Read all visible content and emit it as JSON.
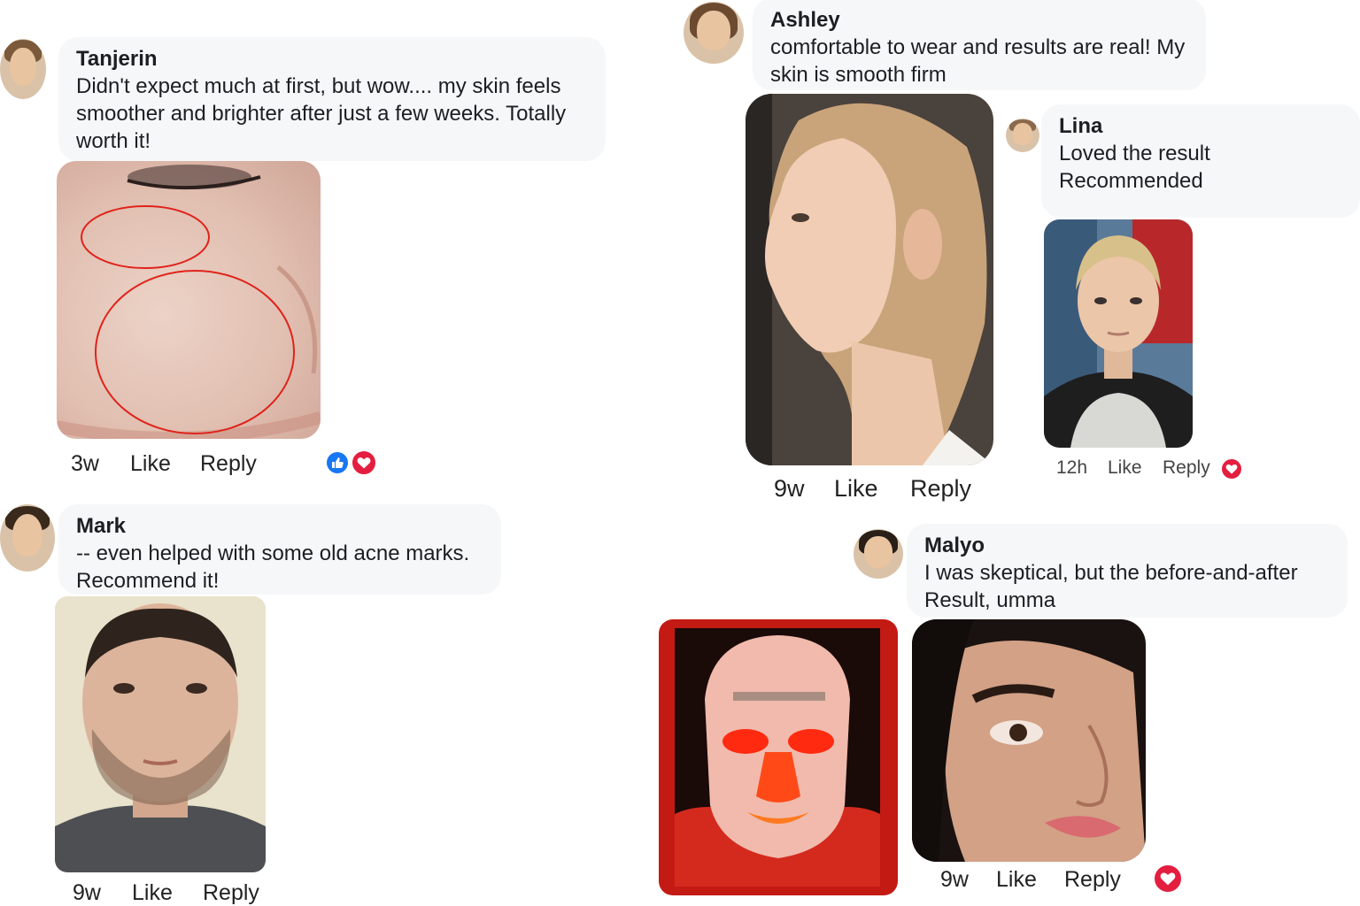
{
  "comments": [
    {
      "name": "Tanjerin",
      "text": "Didn't expect much at first, but wow.... my skin feels smoother and brighter after just a few weeks. Totally worth it!",
      "time": "3w",
      "like": "Like",
      "reply": "Reply"
    },
    {
      "name": "Mark",
      "text": "-- even helped with some old acne marks. Recommend it!",
      "time": "9w",
      "like": "Like",
      "reply": "Reply"
    },
    {
      "name": "Ashley",
      "text": "comfortable to wear and results are real! My skin is smooth firm",
      "time": "9w",
      "like": "Like",
      "reply": "Reply"
    },
    {
      "name": "Lina",
      "text_line1": "Loved the result",
      "text_line2": "Recommended",
      "time": "12h",
      "like": "Like",
      "reply": "Reply"
    },
    {
      "name": "Malyo",
      "text": "I was skeptical, but the before-and-after Result, umma",
      "time": "9w",
      "like": "Like",
      "reply": "Reply"
    }
  ],
  "icons": {
    "like": "thumbs-up-icon",
    "love": "heart-icon"
  },
  "colors": {
    "bubble": "#f6f7f9",
    "like_blue": "#1877f2",
    "love_red": "#e41e3f",
    "annotation_red": "#e0231b"
  }
}
